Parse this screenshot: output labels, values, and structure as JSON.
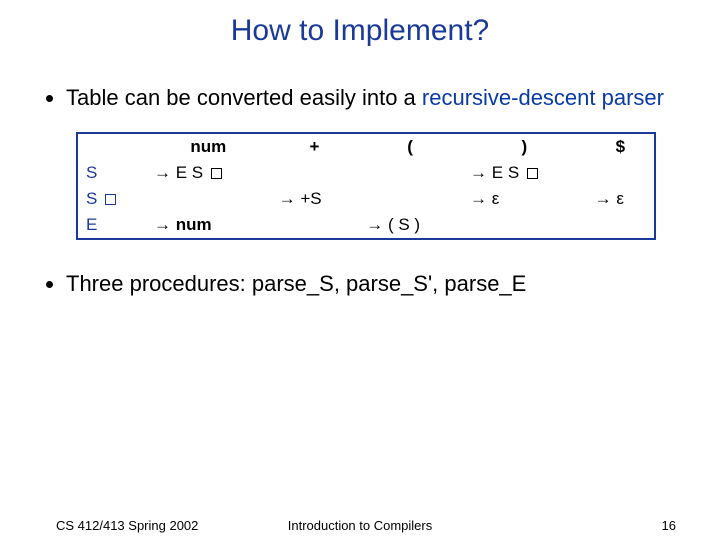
{
  "title": "How to Implement?",
  "bullet1_pre": "Table can be converted easily into a ",
  "bullet1_accent": "recursive-descent parser",
  "bullet2": "Three procedures: parse_S, parse_S', parse_E",
  "table": {
    "head": {
      "c1": "num",
      "c2": "+",
      "c3": "(",
      "c4": ")",
      "c5": "$"
    },
    "rows": {
      "S": {
        "label": "S",
        "num": "→ E S □",
        "plus": "",
        "lparen": "",
        "rparen": "→ E S □",
        "eof": ""
      },
      "Sp": {
        "label": "S □",
        "num": "",
        "plus": "→ +S",
        "lparen": "",
        "rparen": "→ ε",
        "eof": "→ ε"
      },
      "E": {
        "label": "E",
        "num": "→ num",
        "plus": "",
        "lparen": "→ ( S )",
        "rparen": "",
        "eof": ""
      }
    }
  },
  "chart_data": {
    "type": "table",
    "title": "LL(1) predictive parse table",
    "columns": [
      "num",
      "+",
      "(",
      ")",
      "$"
    ],
    "rows": [
      {
        "nonterminal": "S",
        "cells": [
          "E S'",
          "",
          "",
          "E S'",
          ""
        ]
      },
      {
        "nonterminal": "S'",
        "cells": [
          "",
          "+S",
          "",
          "ε",
          "ε"
        ]
      },
      {
        "nonterminal": "E",
        "cells": [
          "num",
          "",
          "( S )",
          "",
          ""
        ]
      }
    ]
  },
  "footer": {
    "left": "CS 412/413  Spring 2002",
    "center": "Introduction to Compilers",
    "right": "16"
  }
}
